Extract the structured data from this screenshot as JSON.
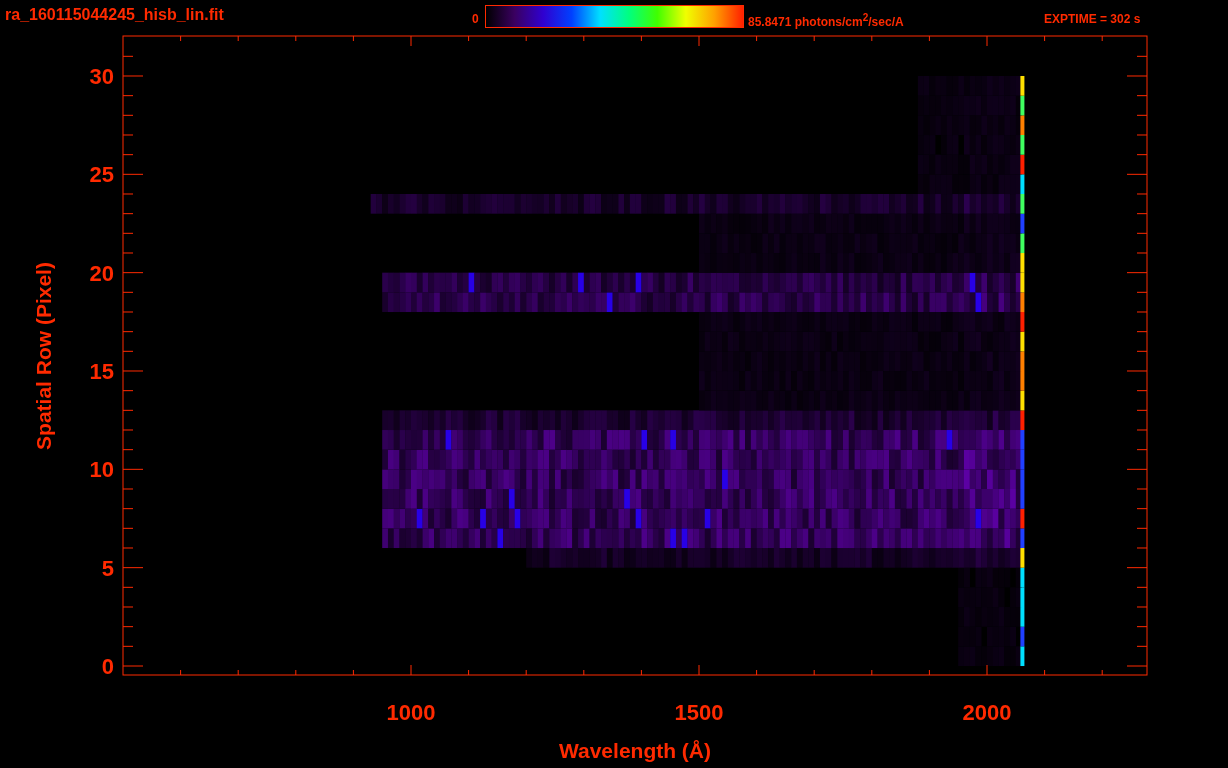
{
  "header": {
    "file_name": "ra_160115044245_hisb_lin.fit",
    "colorbar": {
      "min_label": "0",
      "max_label": "85.8471 photons/cm$^{2}$/sec/A"
    },
    "exposure": "EXPTIME = 302 s"
  },
  "plot": {
    "x_axis": {
      "title": "Wavelength (Å)",
      "tick_labels": [
        "1000",
        "1500",
        "2000"
      ]
    },
    "y_axis": {
      "title": "Spatial Row (Pixel)",
      "tick_labels": [
        "30",
        "25",
        "20",
        "15",
        "10",
        "5",
        "0"
      ]
    }
  }
}
